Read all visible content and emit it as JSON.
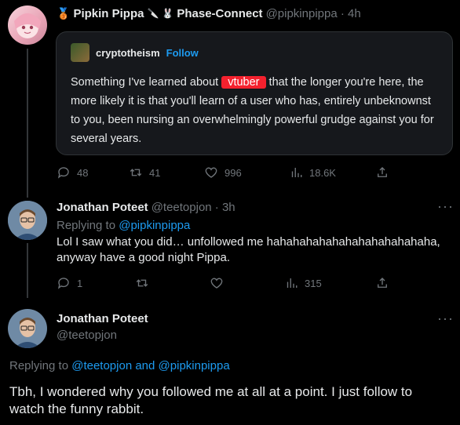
{
  "tweet1": {
    "display_name": "Pipkin Pippa",
    "handle_time": "@pipkinpippa · 4h",
    "name_suffix": "Phase-Connect",
    "quote": {
      "author": "cryptotheism",
      "follow": "Follow",
      "text_before": "Something I've learned about ",
      "highlight": "vtuber",
      "text_after": " that the longer you're here, the more likely it is that you'll learn of a user who has, entirely unbeknownst to you, been nursing an overwhelmingly powerful grudge against you for several years."
    },
    "replies": "48",
    "retweets": "41",
    "likes": "996",
    "views": "18.6K"
  },
  "tweet2": {
    "display_name": "Jonathan Poteet",
    "handle_time": "@teetopjon · 3h",
    "replying_prefix": "Replying to ",
    "replying_handle": "@pipkinpippa",
    "text": "Lol I saw what you did… unfollowed me hahahahahahahahahahahahaha, anyway have a good night Pippa.",
    "replies": "1",
    "views": "315"
  },
  "tweet3": {
    "display_name": "Jonathan Poteet",
    "handle": "@teetopjon",
    "replying_prefix": "Replying to ",
    "replying_handle1": "@teetopjon",
    "replying_and": " and ",
    "replying_handle2": "@pipkinpippa",
    "text": "Tbh, I wondered why you followed me at all at a point. I just follow to watch the funny rabbit."
  },
  "more_glyph": "···",
  "colors": {
    "accent": "#1d9bf0",
    "highlight": "#f4212e",
    "muted": "#71767b",
    "background": "#000000"
  }
}
